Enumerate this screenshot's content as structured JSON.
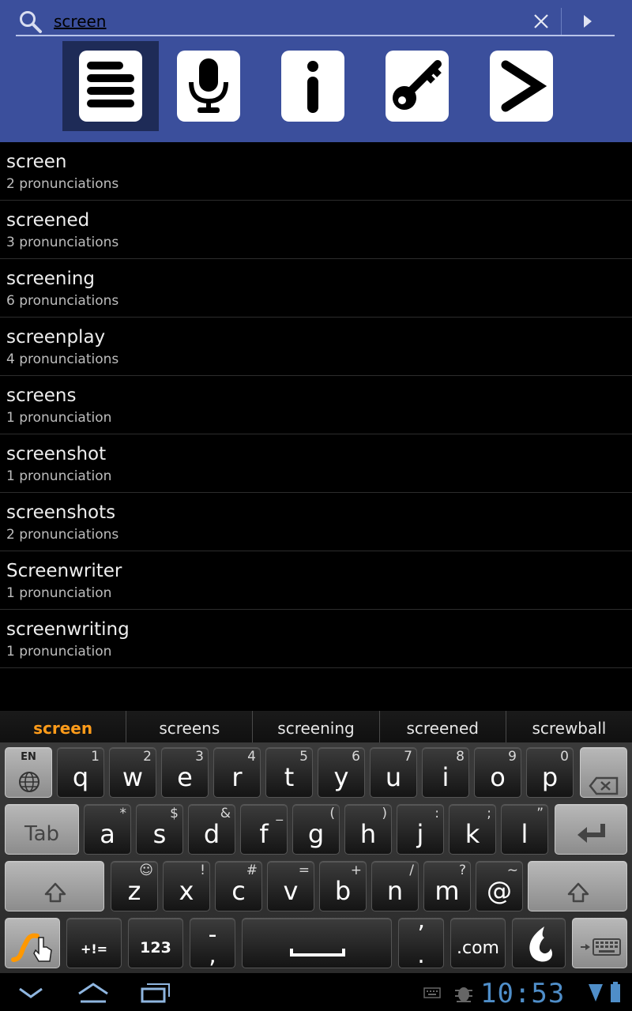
{
  "search": {
    "value": "screen"
  },
  "modes": [
    "list-icon",
    "microphone-icon",
    "info-icon",
    "key-icon",
    "arrow-right-icon"
  ],
  "results": [
    {
      "word": "screen",
      "count": "2 pronunciations"
    },
    {
      "word": "screened",
      "count": "3 pronunciations"
    },
    {
      "word": "screening",
      "count": "6 pronunciations"
    },
    {
      "word": "screenplay",
      "count": "4 pronunciations"
    },
    {
      "word": "screens",
      "count": "1 pronunciation"
    },
    {
      "word": "screenshot",
      "count": "1 pronunciation"
    },
    {
      "word": "screenshots",
      "count": "2 pronunciations"
    },
    {
      "word": "Screenwriter",
      "count": "1 pronunciation"
    },
    {
      "word": "screenwriting",
      "count": "1 pronunciation"
    }
  ],
  "suggestions": [
    "screen",
    "screens",
    "screening",
    "screened",
    "screwball"
  ],
  "keyboard": {
    "lang": "EN",
    "row1": [
      {
        "main": "q",
        "sub": "1"
      },
      {
        "main": "w",
        "sub": "2"
      },
      {
        "main": "e",
        "sub": "3"
      },
      {
        "main": "r",
        "sub": "4"
      },
      {
        "main": "t",
        "sub": "5"
      },
      {
        "main": "y",
        "sub": "6"
      },
      {
        "main": "u",
        "sub": "7"
      },
      {
        "main": "i",
        "sub": "8"
      },
      {
        "main": "o",
        "sub": "9"
      },
      {
        "main": "p",
        "sub": "0"
      }
    ],
    "tab": "Tab",
    "row2": [
      {
        "main": "a",
        "sub": "*"
      },
      {
        "main": "s",
        "sub": "$"
      },
      {
        "main": "d",
        "sub": "&"
      },
      {
        "main": "f",
        "sub": "_"
      },
      {
        "main": "g",
        "sub": "("
      },
      {
        "main": "h",
        "sub": ")"
      },
      {
        "main": "j",
        "sub": ":"
      },
      {
        "main": "k",
        "sub": ";"
      },
      {
        "main": "l",
        "sub": "”"
      }
    ],
    "row3": [
      {
        "main": "z",
        "sub": "☺"
      },
      {
        "main": "x",
        "sub": "!"
      },
      {
        "main": "c",
        "sub": "#"
      },
      {
        "main": "v",
        "sub": "="
      },
      {
        "main": "b",
        "sub": "+"
      },
      {
        "main": "n",
        "sub": "/"
      },
      {
        "main": "m",
        "sub": "?"
      },
      {
        "main": "@",
        "sub": "~"
      }
    ],
    "sym": "+!=",
    "num": "123",
    "dotcom": ".com"
  },
  "status": {
    "time": "10:53"
  },
  "colors": {
    "header": "#3b4f9c",
    "accent": "#ff9c1a",
    "clock": "#4f8ec9"
  }
}
